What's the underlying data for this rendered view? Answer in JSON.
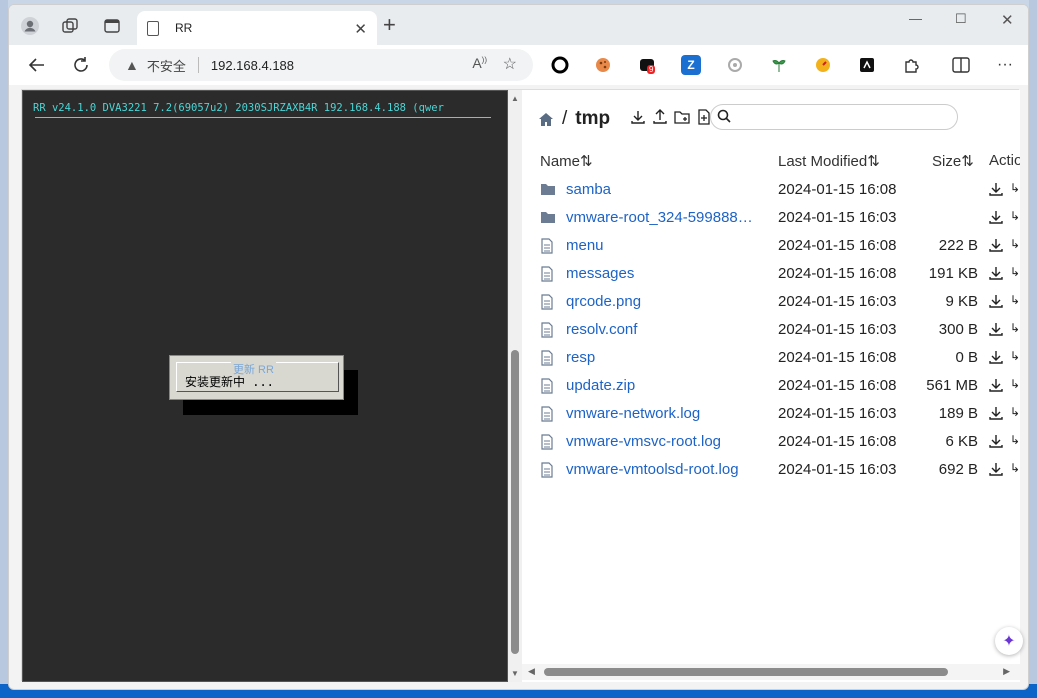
{
  "tab": {
    "title": "RR"
  },
  "address": {
    "security_label": "不安全",
    "url": "192.168.4.188"
  },
  "extensions": {
    "badge_count": "9"
  },
  "terminal": {
    "header_line": "RR v24.1.0 DVA3221 7.2(69057u2) 2030SJRZAXB4R 192.168.4.188 (qwer",
    "dialog_title": "更新 RR",
    "dialog_text": "安装更新中 ..."
  },
  "browser": {
    "crumb_sep": "/",
    "current_dir": "tmp",
    "search_placeholder": "",
    "columns": {
      "name": "Name",
      "modified": "Last Modified",
      "size": "Size",
      "actions": "Actio"
    },
    "files": [
      {
        "name": "samba",
        "modified": "2024-01-15 16:08",
        "size": "",
        "type": "folder"
      },
      {
        "name": "vmware-root_324-599888…",
        "modified": "2024-01-15 16:03",
        "size": "",
        "type": "folder"
      },
      {
        "name": "menu",
        "modified": "2024-01-15 16:08",
        "size": "222 B",
        "type": "file"
      },
      {
        "name": "messages",
        "modified": "2024-01-15 16:08",
        "size": "191 KB",
        "type": "file"
      },
      {
        "name": "qrcode.png",
        "modified": "2024-01-15 16:03",
        "size": "9 KB",
        "type": "file"
      },
      {
        "name": "resolv.conf",
        "modified": "2024-01-15 16:03",
        "size": "300 B",
        "type": "file"
      },
      {
        "name": "resp",
        "modified": "2024-01-15 16:08",
        "size": "0 B",
        "type": "file"
      },
      {
        "name": "update.zip",
        "modified": "2024-01-15 16:08",
        "size": "561 MB",
        "type": "file"
      },
      {
        "name": "vmware-network.log",
        "modified": "2024-01-15 16:03",
        "size": "189 B",
        "type": "file"
      },
      {
        "name": "vmware-vmsvc-root.log",
        "modified": "2024-01-15 16:08",
        "size": "6 KB",
        "type": "file"
      },
      {
        "name": "vmware-vmtoolsd-root.log",
        "modified": "2024-01-15 16:03",
        "size": "692 B",
        "type": "file"
      }
    ]
  },
  "colors": {
    "link": "#1d63c6",
    "terminal_text": "#4ad6d6",
    "terminal_bg": "#2b2b2b"
  }
}
